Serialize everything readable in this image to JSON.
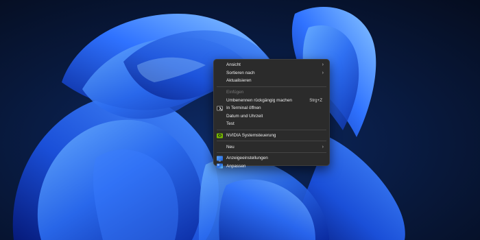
{
  "desktop": {
    "wallpaper_colors": {
      "background": "#0a1a33",
      "bloom_dark": "#0a2a9a",
      "bloom_mid": "#1f5fe8",
      "bloom_light": "#5aa8ff"
    }
  },
  "context_menu": {
    "items": [
      {
        "label": "Ansicht",
        "submenu": "›"
      },
      {
        "label": "Sortieren nach",
        "submenu": "›"
      },
      {
        "label": "Aktualisieren"
      },
      {
        "label": "Einfügen",
        "disabled": true
      },
      {
        "label": "Umbenennen rückgängig machen",
        "shortcut": "Strg+Z"
      },
      {
        "label": "In Terminal öffnen",
        "icon": "terminal-icon"
      },
      {
        "label": "Datum und Uhrzeit"
      },
      {
        "label": "Test"
      },
      {
        "label": "NVIDIA Systemsteuerung",
        "icon": "nvidia-icon"
      },
      {
        "label": "Neu",
        "submenu": "›"
      },
      {
        "label": "Anzeigeeinstellungen",
        "icon": "display-settings-icon"
      },
      {
        "label": "Anpassen",
        "icon": "personalize-icon"
      }
    ]
  }
}
